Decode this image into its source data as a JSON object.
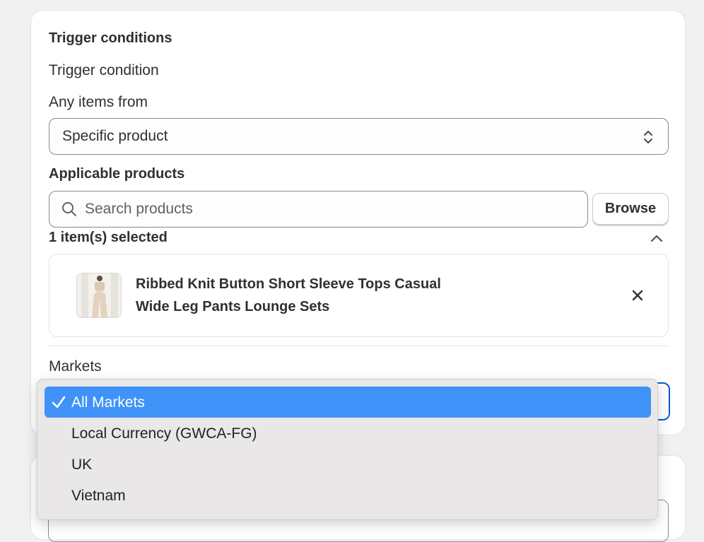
{
  "trigger": {
    "section_title": "Trigger conditions",
    "trigger_condition_label": "Trigger condition",
    "items_from_label": "Any items from",
    "items_from_value": "Specific product"
  },
  "products": {
    "label": "Applicable products",
    "search_placeholder": "Search products",
    "browse_label": "Browse",
    "selected_count": "1 item(s) selected",
    "items": [
      {
        "title_line1": "Ribbed Knit Button Short Sleeve Tops Casual",
        "title_line2": "Wide Leg Pants Lounge Sets"
      }
    ]
  },
  "markets": {
    "label": "Markets",
    "selected": "All Markets",
    "options": [
      {
        "label": "All Markets",
        "selected": true
      },
      {
        "label": "Local Currency (GWCA-FG)",
        "selected": false
      },
      {
        "label": "UK",
        "selected": false
      },
      {
        "label": "Vietnam",
        "selected": false
      }
    ]
  },
  "colors": {
    "focus_border": "#005bd3",
    "dropdown_highlight": "#3f93f8"
  }
}
